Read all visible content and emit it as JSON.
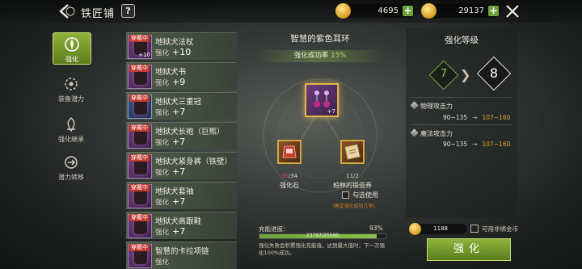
{
  "header": {
    "title": "铁匠铺",
    "help_label": "?",
    "currency_1": "4695",
    "currency_2": "29137"
  },
  "nav": [
    {
      "label": "强化"
    },
    {
      "label": "装备潜力"
    },
    {
      "label": "强化继承"
    },
    {
      "label": "潜力转移"
    }
  ],
  "equip_tag": "穿戴中",
  "items": [
    {
      "name": "地狱犬法杖",
      "stat_label": "强化",
      "level": "+10",
      "slot_level": "+10"
    },
    {
      "name": "地狱犬书",
      "stat_label": "强化",
      "level": "+9"
    },
    {
      "name": "地狱犬三重冠",
      "stat_label": "强化",
      "level": "+7"
    },
    {
      "name": "地狱犬长袍（巨熊）",
      "stat_label": "强化",
      "level": "+7"
    },
    {
      "name": "地狱犬紧身裤（铁壁）",
      "stat_label": "强化",
      "level": "+7"
    },
    {
      "name": "地狱犬套袖",
      "stat_label": "强化",
      "level": "+7"
    },
    {
      "name": "地狱犬高跟鞋",
      "stat_label": "强化",
      "level": "+7"
    },
    {
      "name": "智慧的卡拉项链",
      "stat_label": "强化",
      "level": ""
    }
  ],
  "center": {
    "item_title": "智慧的紫色耳环",
    "rate_label": "强化成功率",
    "rate_value": "15%",
    "main_slot_level": "+7",
    "mat1": {
      "have": "30",
      "need": "/34",
      "name": "强化石"
    },
    "mat2": {
      "count": "11/2",
      "name": "柏林的锻造券"
    },
    "check_label": "勾选使用",
    "note": "(确定强化成功几率)",
    "progress_label": "充能进度：",
    "progress_pct": "93%",
    "progress_value": 0.93,
    "progress_text": "23797/25500",
    "desc": "强化失败会积累强化充能值，达到最大值时，下一次强化100%成功。"
  },
  "right": {
    "title": "强化等级",
    "from_level": "7",
    "to_level": "8",
    "attrs": [
      {
        "name": "物理攻击力",
        "old": "90~135",
        "new": "107~160"
      },
      {
        "name": "魔法攻击力",
        "old": "90~135",
        "new": "107~160"
      }
    ],
    "gold_amount": "1188",
    "gold_label": "可用非绑金币",
    "action_label": "强化"
  },
  "colors": {
    "accent_green": "#8fb23a",
    "upgrade_orange": "#e0a33b",
    "warning_red": "#e04848"
  }
}
